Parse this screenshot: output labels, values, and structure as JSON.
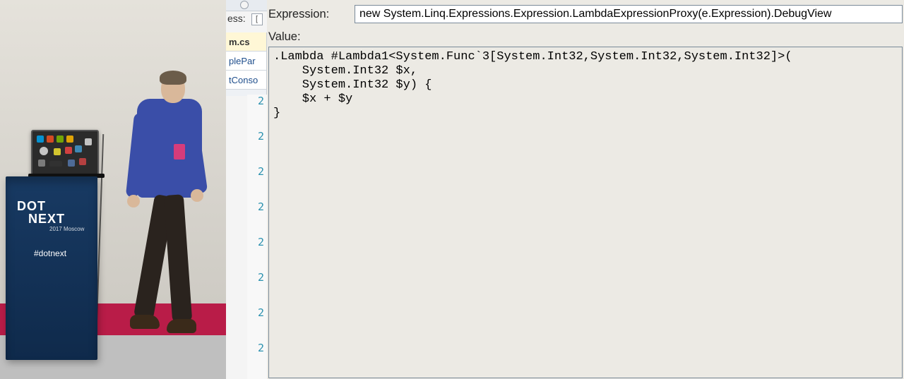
{
  "stage": {
    "podium_line1": "DOT",
    "podium_line2": "NEXT",
    "podium_subtitle": "2017 Moscow",
    "hashtag": "#dotnext"
  },
  "ide": {
    "process_label": "ess:",
    "tabs": [
      {
        "label": "m.cs",
        "active": true
      },
      {
        "label": "plePar",
        "active": false
      },
      {
        "label": "tConso",
        "active": false
      }
    ],
    "line_numbers": [
      "2",
      "2",
      "2",
      "2",
      "2",
      "2",
      "2",
      "2"
    ]
  },
  "quickwatch": {
    "expression_label": "Expression:",
    "expression_value": "new System.Linq.Expressions.Expression.LambdaExpressionProxy(e.Expression).DebugView",
    "value_label": "Value:",
    "value_text": ".Lambda #Lambda1<System.Func`3[System.Int32,System.Int32,System.Int32]>(\n    System.Int32 $x,\n    System.Int32 $y) {\n    $x + $y\n}"
  }
}
